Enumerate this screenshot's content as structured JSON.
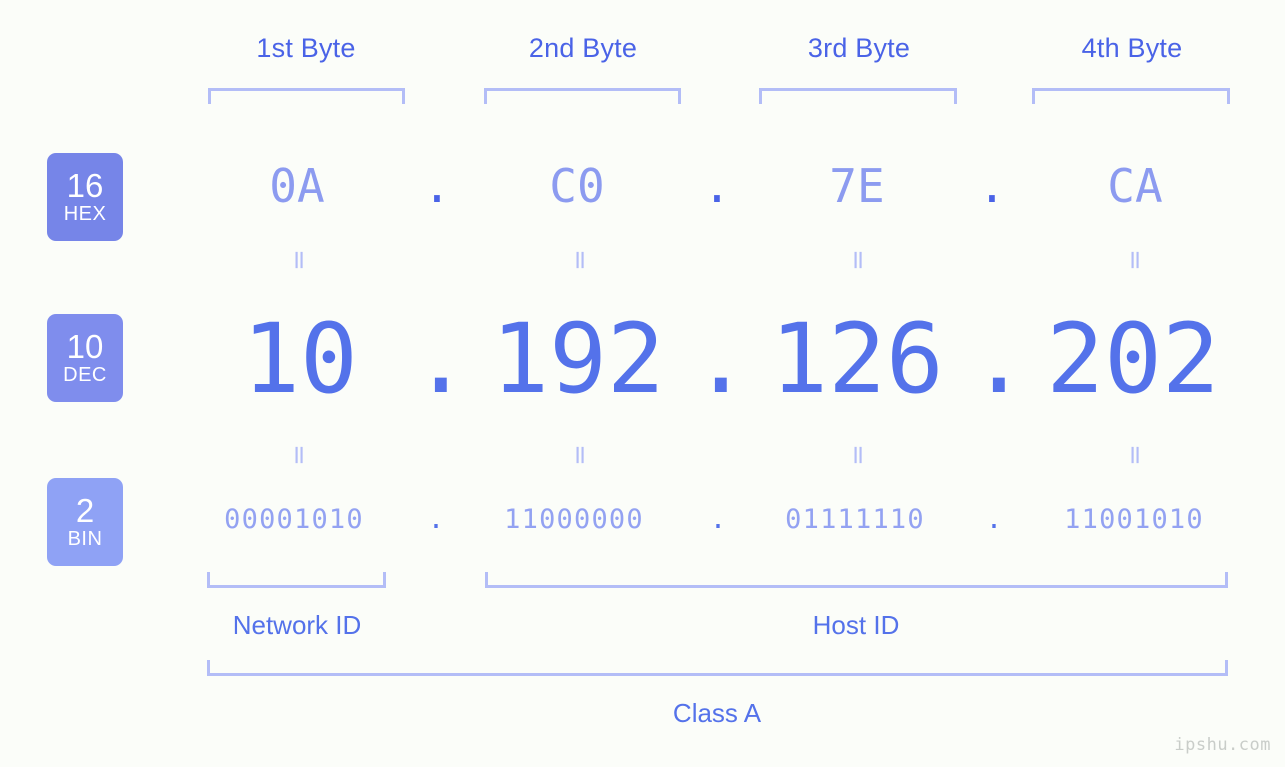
{
  "background": "#fbfdf9",
  "accent": "#5472ea",
  "accent_light": "#b3bdf7",
  "headers": [
    {
      "label": "1st Byte"
    },
    {
      "label": "2nd Byte"
    },
    {
      "label": "3rd Byte"
    },
    {
      "label": "4th Byte"
    }
  ],
  "badges": {
    "hex": {
      "num": "16",
      "sys": "HEX",
      "color": "#7685e8"
    },
    "dec": {
      "num": "10",
      "sys": "DEC",
      "color": "#7f8ded"
    },
    "bin": {
      "num": "2",
      "sys": "BIN",
      "color": "#8fa2f5"
    }
  },
  "rows": {
    "hex": {
      "values": [
        "0A",
        "C0",
        "7E",
        "CA"
      ],
      "separator": "."
    },
    "dec": {
      "values": [
        "10",
        "192",
        "126",
        "202"
      ],
      "separator": "."
    },
    "bin": {
      "values": [
        "00001010",
        "11000000",
        "01111110",
        "11001010"
      ],
      "separator": "."
    }
  },
  "equals_mark": "=",
  "footer": {
    "network_id": "Network ID",
    "host_id": "Host ID",
    "class": "Class A"
  },
  "watermark": "ipshu.com"
}
